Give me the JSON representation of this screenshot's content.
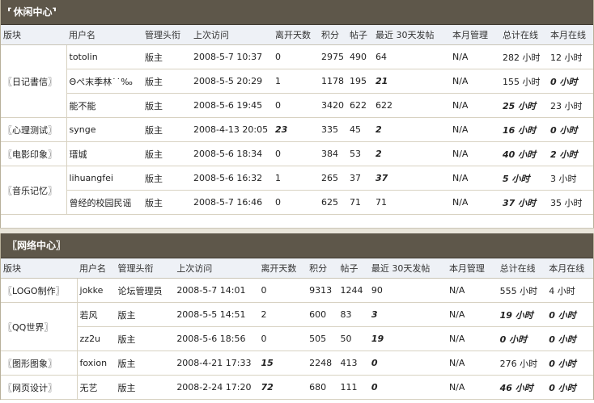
{
  "sections": [
    {
      "title": "休闲中心",
      "title_prefix": "⸢",
      "columns": [
        "版块",
        "用户名",
        "管理头衔",
        "上次访问",
        "离开天数",
        "积分",
        "帖子",
        "最近 30天发帖",
        "本月管理",
        "总计在线",
        "本月在线"
      ],
      "groups": [
        {
          "forum": "〖日记書信〗",
          "rows": [
            {
              "user": "totolin",
              "title": "版主",
              "last": "2008-5-7 10:37",
              "days": "0",
              "points": "2975",
              "posts": "490",
              "recent": "64",
              "manage": "N/A",
              "total": "282 小时",
              "month": "12 小时"
            },
            {
              "user": "Θぺ末季林˙˙‰",
              "title": "版主",
              "last": "2008-5-5 20:29",
              "days": "1",
              "points": "1178",
              "posts": "195",
              "recent": "21",
              "manage": "N/A",
              "total": "155 小时",
              "month": "0 小时"
            },
            {
              "user": "能不能",
              "title": "版主",
              "last": "2008-5-6 19:45",
              "days": "0",
              "points": "3420",
              "posts": "622",
              "recent": "622",
              "manage": "N/A",
              "total": "25 小时",
              "month": "23 小时"
            }
          ]
        },
        {
          "forum": "〖心理测试〗",
          "rows": [
            {
              "user": "synge",
              "title": "版主",
              "last": "2008-4-13 20:05",
              "days": "23",
              "points": "335",
              "posts": "45",
              "recent": "2",
              "manage": "N/A",
              "total": "16 小时",
              "month": "0 小时"
            }
          ]
        },
        {
          "forum": "〖电影印象〗",
          "rows": [
            {
              "user": "瑨城",
              "title": "版主",
              "last": "2008-5-6 18:34",
              "days": "0",
              "points": "384",
              "posts": "53",
              "recent": "2",
              "manage": "N/A",
              "total": "40 小时",
              "month": "2 小时"
            }
          ]
        },
        {
          "forum": "〖音乐记忆〗",
          "rows": [
            {
              "user": "lihuangfei",
              "title": "版主",
              "last": "2008-5-6 16:32",
              "days": "1",
              "points": "265",
              "posts": "37",
              "recent": "37",
              "manage": "N/A",
              "total": "5 小时",
              "month": "3 小时"
            },
            {
              "user": "曾经的校园民谣",
              "title": "版主",
              "last": "2008-5-7 16:46",
              "days": "0",
              "points": "625",
              "posts": "71",
              "recent": "71",
              "manage": "N/A",
              "total": "37 小时",
              "month": "35 小时"
            }
          ]
        }
      ]
    },
    {
      "title": "〖网络中心〗",
      "title_prefix": "",
      "columns": [
        "版块",
        "用户名",
        "管理头衔",
        "上次访问",
        "离开天数",
        "积分",
        "帖子",
        "最近 30天发帖",
        "本月管理",
        "总计在线",
        "本月在线"
      ],
      "groups": [
        {
          "forum": "〖LOGO制作〗",
          "rows": [
            {
              "user": "jokke",
              "title": "论坛管理员",
              "last": "2008-5-7 14:01",
              "days": "0",
              "points": "9313",
              "posts": "1244",
              "recent": "90",
              "manage": "N/A",
              "total": "555 小时",
              "month": "4 小时"
            }
          ]
        },
        {
          "forum": "〖QQ世界〗",
          "rows": [
            {
              "user": "若风",
              "title": "版主",
              "last": "2008-5-5 14:51",
              "days": "2",
              "points": "600",
              "posts": "83",
              "recent": "3",
              "manage": "N/A",
              "total": "19 小时",
              "month": "0 小时"
            },
            {
              "user": "zz2u",
              "title": "版主",
              "last": "2008-5-6 18:56",
              "days": "0",
              "points": "505",
              "posts": "50",
              "recent": "19",
              "manage": "N/A",
              "total": "0 小时",
              "month": "0 小时"
            }
          ]
        },
        {
          "forum": "〖图形图象〗",
          "rows": [
            {
              "user": "foxion",
              "title": "版主",
              "last": "2008-4-21 17:33",
              "days": "15",
              "points": "2248",
              "posts": "413",
              "recent": "0",
              "manage": "N/A",
              "total": "276 小时",
              "month": "0 小时"
            }
          ]
        },
        {
          "forum": "〖网页设计〗",
          "rows": [
            {
              "user": "无艺",
              "title": "版主",
              "last": "2008-2-24 17:20",
              "days": "72",
              "points": "680",
              "posts": "111",
              "recent": "0",
              "manage": "N/A",
              "total": "46 小时",
              "month": "0 小时"
            }
          ]
        }
      ]
    }
  ]
}
